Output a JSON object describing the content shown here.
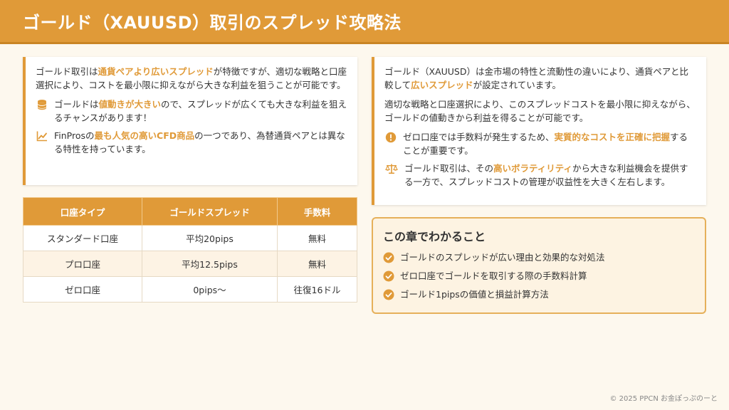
{
  "header": {
    "title": "ゴールド（XAUUSD）取引のスプレッド攻略法"
  },
  "left_card": {
    "intro": {
      "pre": "ゴールド取引は",
      "hl": "通貨ペアより広いスプレッド",
      "post": "が特徴ですが、適切な戦略と口座選択により、コストを最小限に抑えながら大きな利益を狙うことが可能です。"
    },
    "bullets": [
      {
        "icon": "coins-icon",
        "pre": "ゴールドは",
        "hl": "値動きが大きい",
        "post": "ので、スプレッドが広くても大きな利益を狙えるチャンスがあります！"
      },
      {
        "icon": "chart-line-icon",
        "pre": "FinProsの",
        "hl": "最も人気の高いCFD商品",
        "post": "の一つであり、為替通貨ペアとは異なる特性を持っています。"
      }
    ]
  },
  "table": {
    "headers": [
      "口座タイプ",
      "ゴールドスプレッド",
      "手数料"
    ],
    "rows": [
      [
        "スタンダード口座",
        "平均20pips",
        "無料"
      ],
      [
        "プロ口座",
        "平均12.5pips",
        "無料"
      ],
      [
        "ゼロ口座",
        "0pips〜",
        "往復16ドル"
      ]
    ]
  },
  "right_card": {
    "p1": {
      "pre": "ゴールド（XAUUSD）は金市場の特性と流動性の違いにより、通貨ペアと比較して",
      "hl": "広いスプレッド",
      "post": "が設定されています。"
    },
    "p2": "適切な戦略と口座選択により、このスプレッドコストを最小限に抑えながら、ゴールドの値動きから利益を得ることが可能です。",
    "bullets": [
      {
        "icon": "exclamation-icon",
        "pre": "ゼロ口座では手数料が発生するため、",
        "hl": "実質的なコストを正確に把握",
        "post": "することが重要です。"
      },
      {
        "icon": "scale-icon",
        "pre": "ゴールド取引は、その",
        "hl": "高いボラティリティ",
        "post": "から大きな利益機会を提供する一方で、スプレッドコストの管理が収益性を大きく左右します。"
      }
    ]
  },
  "summary": {
    "title": "この章でわかること",
    "items": [
      "ゴールドのスプレッドが広い理由と効果的な対処法",
      "ゼロ口座でゴールドを取引する際の手数料計算",
      "ゴールド1pipsの価値と損益計算方法"
    ]
  },
  "footer": {
    "text": "© 2025 PPCN お金ぽっぷのーと"
  },
  "colors": {
    "accent": "#e09a38",
    "background": "#fdf8ee"
  }
}
